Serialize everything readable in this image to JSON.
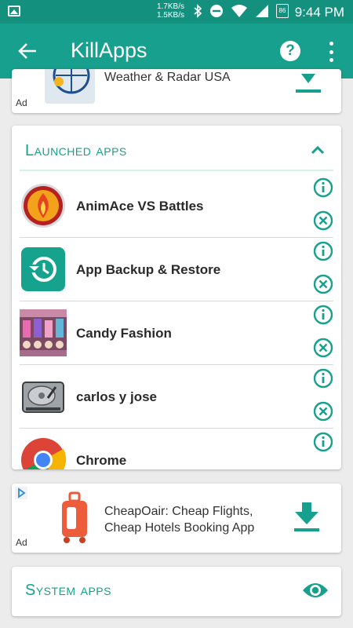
{
  "status_bar": {
    "net_up": "1.7KB/s",
    "net_down": "1.5KB/s",
    "time": "9:44 PM",
    "battery": "86"
  },
  "app_bar": {
    "title": "KillApps"
  },
  "ad_top": {
    "label": "Ad",
    "title": "Weather & Radar USA"
  },
  "launched_section": {
    "title": "Launched apps",
    "apps": [
      {
        "name": "AnimAce VS Battles"
      },
      {
        "name": "App Backup & Restore"
      },
      {
        "name": "Candy Fashion"
      },
      {
        "name": "carlos y jose"
      },
      {
        "name": "Chrome"
      }
    ]
  },
  "ad_bottom": {
    "label": "Ad",
    "title": "CheapOair: Cheap Flights, Cheap Hotels Booking App"
  },
  "system_section": {
    "title": "System apps"
  },
  "colors": {
    "primary": "#16a08d",
    "status_bar": "#14907f",
    "background": "#ececec"
  }
}
